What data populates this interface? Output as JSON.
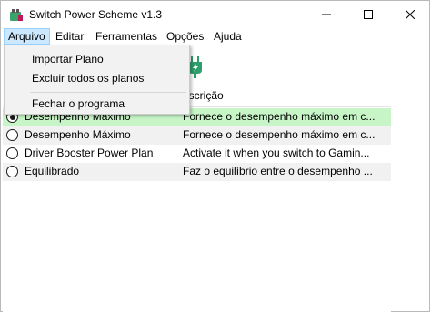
{
  "window": {
    "title": "Switch Power Scheme v1.3"
  },
  "menubar": {
    "items": [
      {
        "label": "Arquivo"
      },
      {
        "label": "Editar"
      },
      {
        "label": "Ferramentas"
      },
      {
        "label": "Opções"
      },
      {
        "label": "Ajuda"
      }
    ]
  },
  "dropdown": {
    "items": [
      {
        "label": "Importar Plano"
      },
      {
        "label": "Excluir todos os planos"
      },
      {
        "label": "Fechar o programa"
      }
    ]
  },
  "listview": {
    "columns": [
      {
        "label": ""
      },
      {
        "label": "escrição"
      }
    ],
    "rows": [
      {
        "name": "Desempenho Máximo",
        "description": "Fornece o desempenho máximo em c...",
        "selected": true
      },
      {
        "name": "Desempenho Máximo",
        "description": "Fornece o desempenho máximo em c...",
        "selected": false
      },
      {
        "name": "Driver Booster Power Plan",
        "description": "Activate it when you switch to Gamin...",
        "selected": false
      },
      {
        "name": "Equilibrado",
        "description": "Faz o equilíbrio entre o desempenho ...",
        "selected": false
      }
    ]
  },
  "colors": {
    "active_row": "#c7f5c7",
    "menu_highlight": "#cce8ff",
    "toolbar_icon": "#2e9e6a"
  },
  "icons": [
    "app-icon",
    "minimize-icon",
    "maximize-icon",
    "close-icon",
    "power-plug-icon",
    "radio-icon"
  ]
}
